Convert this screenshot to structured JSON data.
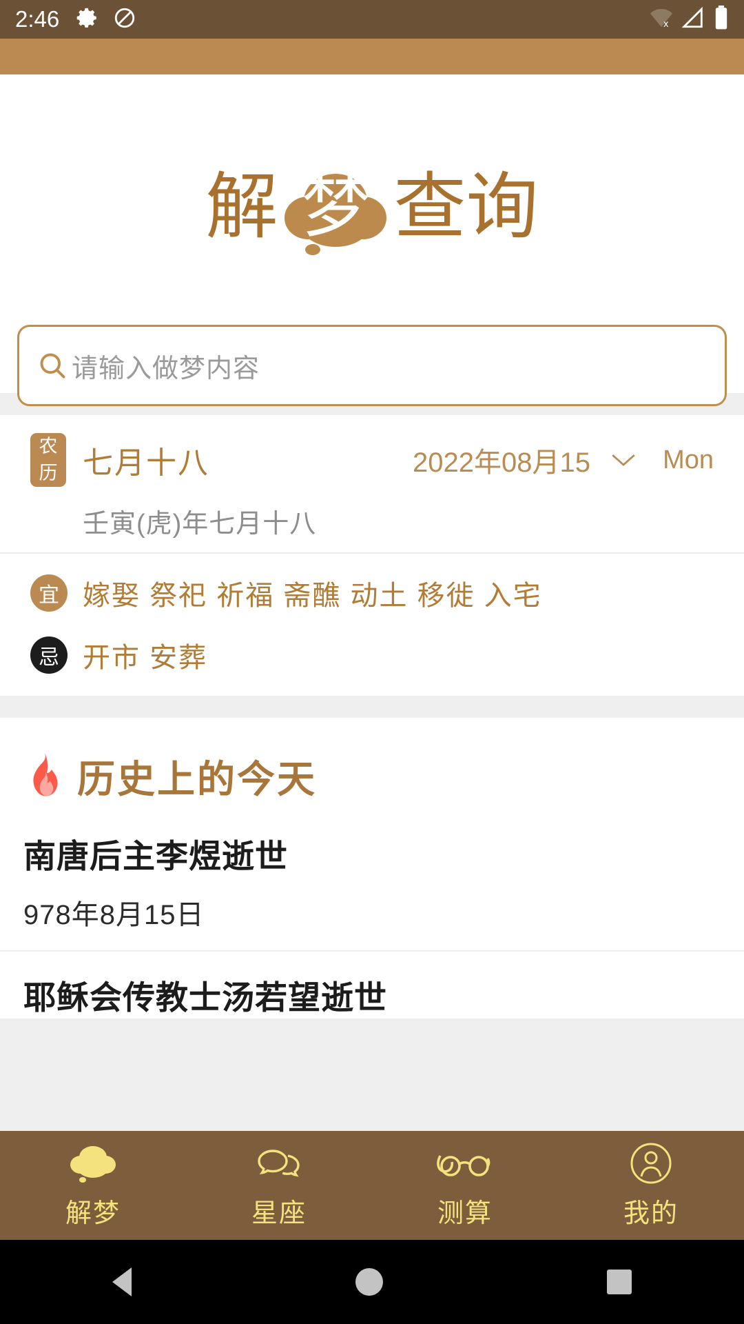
{
  "statusbar": {
    "time": "2:46",
    "icons_left": [
      "gear-icon",
      "do-not-disturb-icon"
    ],
    "icons_right": [
      "wifi-off-icon",
      "signal-icon",
      "battery-icon"
    ],
    "bg_color": "#6b5236"
  },
  "banner": {
    "bg_color": "#bb8a53"
  },
  "logo": {
    "char1": "解",
    "bubble_char": "梦",
    "char3": "查",
    "char4": "询",
    "full_text": "解梦查询",
    "color": "#a8712e"
  },
  "search": {
    "placeholder": "请输入做梦内容",
    "value": "",
    "icon": "search-icon",
    "border_color": "#bf8d4d"
  },
  "lunar_card": {
    "badge": "农历",
    "lunar_date": "七月十八",
    "solar_date": "2022年08月15",
    "chevron": "chevron-down-icon",
    "weekday": "Mon",
    "ganzhi": "壬寅(虎)年七月十八",
    "yi": {
      "label": "宜",
      "items": "嫁娶 祭祀 祈福 斋醮 动土 移徙 入宅"
    },
    "ji": {
      "label": "忌",
      "items": "开市 安葬"
    },
    "accent_color": "#b07c36"
  },
  "history": {
    "icon": "fire-icon",
    "title": "历史上的今天",
    "items": [
      {
        "name": "南唐后主李煜逝世",
        "date": "978年8月15日"
      },
      {
        "name": "耶稣会传教士汤若望逝世",
        "date": ""
      }
    ]
  },
  "tabbar": {
    "bg_color": "#7d5d3b",
    "label_color": "#f3e27e",
    "items": [
      {
        "label": "解梦",
        "icon": "dream-cloud-icon",
        "active": true
      },
      {
        "label": "星座",
        "icon": "chat-bubbles-icon",
        "active": false
      },
      {
        "label": "测算",
        "icon": "glasses-icon",
        "active": false
      },
      {
        "label": "我的",
        "icon": "person-circle-icon",
        "active": false
      }
    ]
  },
  "android_nav": {
    "back": "back-triangle-icon",
    "home": "home-circle-icon",
    "recent": "recent-square-icon"
  }
}
